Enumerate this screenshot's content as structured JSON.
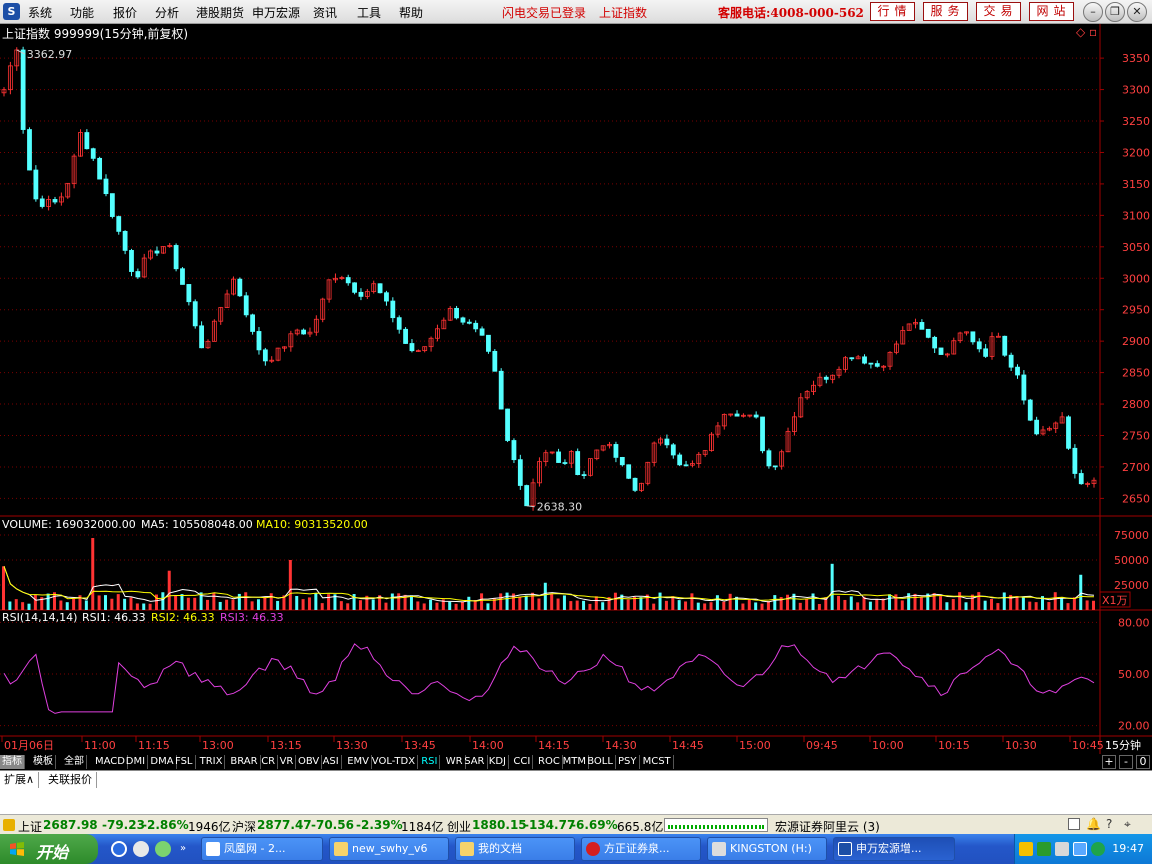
{
  "menubar": {
    "logo": "S",
    "items": [
      "系统",
      "功能",
      "报价",
      "分析",
      "港股期货",
      "申万宏源",
      "资讯",
      "工具",
      "帮助"
    ],
    "status_login": "闪电交易已登录",
    "status_index": "上证指数",
    "hotline": "客服电话:4008-000-562",
    "buttons": [
      "行情",
      "服务",
      "交易",
      "网站"
    ]
  },
  "header": {
    "title": "上证指数 999999(15分钟,前复权)"
  },
  "chart_data": [
    {
      "type": "candlestick",
      "title": "上证指数 999999(15分钟,前复权)",
      "ylim": [
        2622,
        3382
      ],
      "y_ticks": [
        2650,
        2700,
        2750,
        2800,
        2850,
        2900,
        2950,
        3000,
        3050,
        3100,
        3150,
        3200,
        3250,
        3300,
        3350
      ],
      "annotations": [
        {
          "label": "3362.97",
          "value": 3362.97
        },
        {
          "label": "2638.30",
          "value": 2638.3
        }
      ],
      "close_path": [
        3300,
        3363,
        3200,
        3120,
        3120,
        3120,
        3160,
        3230,
        3200,
        3150,
        3100,
        3050,
        3000,
        3030,
        3045,
        3055,
        3010,
        2960,
        2890,
        2910,
        2960,
        3000,
        2960,
        2900,
        2870,
        2880,
        2900,
        2920,
        2910,
        2950,
        3005,
        3005,
        2985,
        2975,
        2990,
        2960,
        2930,
        2890,
        2880,
        2900,
        2930,
        2950,
        2935,
        2920,
        2900,
        2850,
        2750,
        2700,
        2638,
        2710,
        2730,
        2700,
        2720,
        2680,
        2720,
        2740,
        2720,
        2690,
        2660,
        2700,
        2750,
        2740,
        2700,
        2700,
        2720,
        2750,
        2790,
        2790,
        2780,
        2775,
        2700,
        2710,
        2760,
        2810,
        2830,
        2840,
        2850,
        2870,
        2880,
        2870,
        2860,
        2870,
        2900,
        2930,
        2920,
        2900,
        2880,
        2890,
        2930,
        2900,
        2880,
        2920,
        2870,
        2840,
        2780,
        2750,
        2760,
        2780,
        2700,
        2660,
        2680
      ]
    },
    {
      "type": "bar",
      "title": "VOLUME",
      "ylim": [
        0,
        80000
      ],
      "y_ticks": [
        25000,
        50000,
        75000
      ],
      "unit": "X1万",
      "series": [
        {
          "name": "VOLUME",
          "value_label": "169032000.00",
          "color": "#ffffff"
        },
        {
          "name": "MA5",
          "value_label": "105508048.00",
          "color": "#ffffff"
        },
        {
          "name": "MA10",
          "value_label": "90313520.00",
          "color": "#ffff00"
        }
      ]
    },
    {
      "type": "line",
      "title": "RSI(14,14,14)",
      "ylim": [
        14,
        86
      ],
      "y_ticks": [
        20,
        50,
        80
      ],
      "series": [
        {
          "name": "RSI1",
          "value_label": "46.33",
          "color": "#ffffff"
        },
        {
          "name": "RSI2",
          "value_label": "46.33",
          "color": "#ffff00"
        },
        {
          "name": "RSI3",
          "value_label": "46.33",
          "color": "#e040e0"
        }
      ],
      "values_rsi3": [
        50,
        45,
        55,
        60,
        28,
        28,
        28,
        28,
        55,
        70,
        60,
        52,
        48,
        43,
        46,
        55,
        60,
        50,
        48,
        44,
        40,
        38,
        44,
        50,
        55,
        58,
        54,
        48,
        42,
        38,
        45,
        55,
        65,
        68,
        60,
        50,
        45,
        42,
        40,
        44,
        48,
        42,
        38,
        35,
        38,
        45,
        60,
        68,
        62,
        55,
        50,
        48,
        46,
        50,
        55,
        60,
        58,
        50,
        44,
        40,
        42,
        48,
        52,
        56,
        60,
        55,
        50,
        45,
        42,
        48,
        54,
        62,
        68,
        64,
        58,
        52,
        48,
        46,
        50,
        56,
        62,
        66,
        60,
        54,
        48,
        44,
        40,
        44,
        50,
        56,
        60,
        64,
        58,
        52,
        46,
        42,
        38,
        40,
        44,
        48,
        46
      ]
    }
  ],
  "volume_header": {
    "volume": "VOLUME: 169032000.00",
    "ma5": "MA5: 105508048.00",
    "ma10": "MA10: 90313520.00"
  },
  "rsi_header": {
    "label": "RSI(14,14,14)",
    "rsi1": "RSI1: 46.33",
    "rsi2": "RSI2: 46.33",
    "rsi3": "RSI3: 46.33"
  },
  "x_axis_labels": [
    "01月06日",
    "11:00",
    "11:15",
    "13:00",
    "13:15",
    "13:30",
    "13:45",
    "14:00",
    "14:15",
    "14:30",
    "14:45",
    "15:00",
    "09:45",
    "10:00",
    "10:15",
    "10:30",
    "10:45"
  ],
  "period_label": "15分钟",
  "indicator_tabs": [
    "指标",
    "模板",
    "全部",
    "MACD",
    "DMI",
    "DMA",
    "FSL",
    "TRIX",
    "BRAR",
    "CR",
    "VR",
    "OBV",
    "ASI",
    "EMV",
    "VOL-TDX",
    "RSI",
    "WR",
    "SAR",
    "KDJ",
    "CCI",
    "ROC",
    "MTM",
    "BOLL",
    "PSY",
    "MCST"
  ],
  "active_tab": "RSI",
  "tab_controls": [
    "+",
    "-",
    "0"
  ],
  "ext_tabs": [
    "扩展∧",
    "关联报价"
  ],
  "ticker": {
    "sh_name": "上证",
    "sh_value": "2687.98",
    "sh_change": "-79.23",
    "sh_pct": "-2.86%",
    "sh_amount": "1946亿",
    "hs_name": "沪深",
    "hs_value": "2877.47",
    "hs_change": "-70.56",
    "hs_pct": "-2.39%",
    "hs_amount": "1184亿",
    "cy_name": "创业",
    "cy_value": "1880.15",
    "cy_change": "-134.77",
    "cy_pct": "-6.69%",
    "cy_amount": "665.8亿",
    "broker": "宏源证券阿里云 (3)"
  },
  "taskbar": {
    "start": "开始",
    "tasks": [
      "凤凰网 - 2...",
      "new_swhy_v6",
      "我的文档",
      "方正证券泉...",
      "KINGSTON (H:)",
      "申万宏源增..."
    ],
    "clock": "19:47"
  }
}
